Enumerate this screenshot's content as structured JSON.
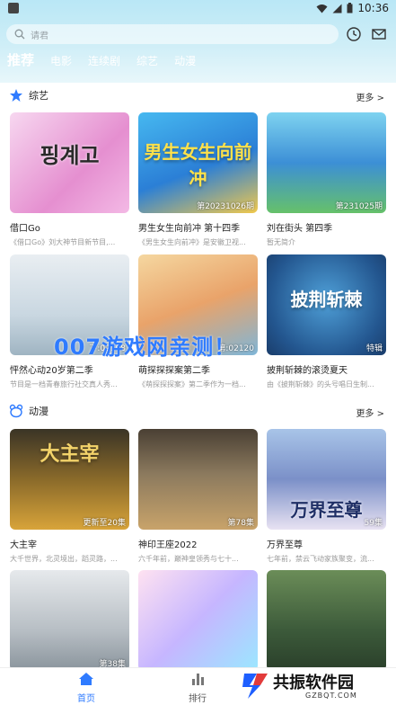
{
  "status": {
    "time": "10:36"
  },
  "search": {
    "placeholder": "请君"
  },
  "tabs": [
    {
      "label": "推荐",
      "active": true
    },
    {
      "label": "电影",
      "active": false
    },
    {
      "label": "连续剧",
      "active": false
    },
    {
      "label": "综艺",
      "active": false
    },
    {
      "label": "动漫",
      "active": false
    }
  ],
  "variety": {
    "title": "综艺",
    "more": "更多 >",
    "items": [
      {
        "title": "借口Go",
        "subtitle": "《借口Go》刘大神节目新节目,...",
        "tag": "",
        "poster_text": "핑계고"
      },
      {
        "title": "男生女生向前冲 第十四季",
        "subtitle": "《男生女生向前冲》是安徽卫视...",
        "tag": "第20231026期",
        "poster_text": "男生女生向前冲"
      },
      {
        "title": "刘在街头 第四季",
        "subtitle": "暂无简介",
        "tag": "第231025期",
        "poster_text": ""
      },
      {
        "title": "怦然心动20岁第二季",
        "subtitle": "节目是一档青春旅行社交真人秀...",
        "tag": "下:02108",
        "poster_text": ""
      },
      {
        "title": "萌探探探案第二季",
        "subtitle": "《萌探探探案》第二季作为一档...",
        "tag": "第:02120",
        "poster_text": ""
      },
      {
        "title": "披荆斩棘的滚烫夏天",
        "subtitle": "由《披荆斩棘》的头号唱日生制...",
        "tag": "特辑",
        "poster_text": "披荆斩棘"
      }
    ]
  },
  "anime": {
    "title": "动漫",
    "more": "更多 >",
    "items": [
      {
        "title": "大主宰",
        "subtitle": "大千世界，北灵境出，蹈灵路，...",
        "tag": "更新至20集",
        "poster_text": "大主宰"
      },
      {
        "title": "神印王座2022",
        "subtitle": "六千年前，巅神皇领秀与七十...",
        "tag": "第78集",
        "poster_text": ""
      },
      {
        "title": "万界至尊",
        "subtitle": "七年前，禁云飞动家族聚变，流...",
        "tag": "59集",
        "poster_text": "万界至尊"
      },
      {
        "title": "",
        "subtitle": "",
        "tag": "第38集",
        "poster_text": ""
      },
      {
        "title": "",
        "subtitle": "",
        "tag": "",
        "poster_text": ""
      },
      {
        "title": "",
        "subtitle": "",
        "tag": "",
        "poster_text": ""
      }
    ]
  },
  "watermark": "007游戏网亲测！",
  "nav": {
    "home": "首页",
    "rank": "排行"
  },
  "brand": {
    "name": "共振软件园",
    "domain": "GZBQT.COM"
  },
  "colors": {
    "accent": "#2f7bff",
    "header": "#c6ecf7"
  }
}
